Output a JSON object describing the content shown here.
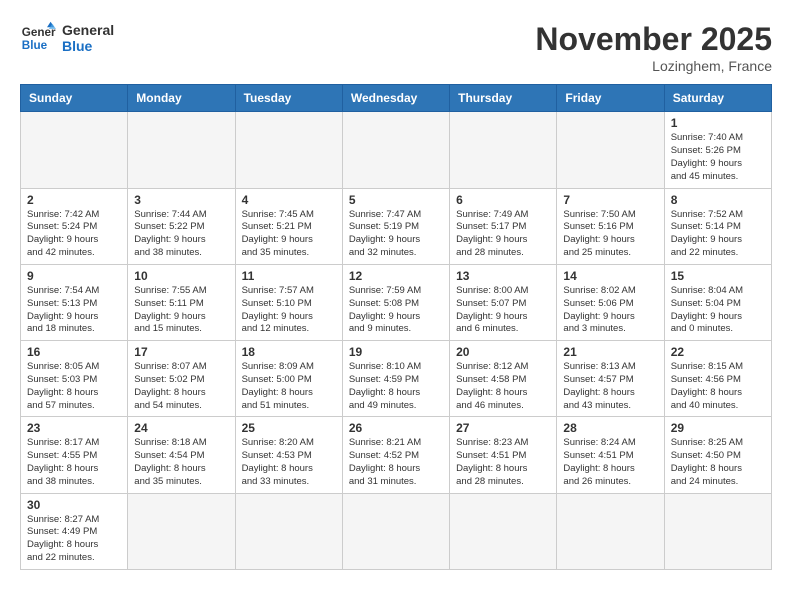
{
  "header": {
    "logo_general": "General",
    "logo_blue": "Blue",
    "month_title": "November 2025",
    "location": "Lozinghem, France"
  },
  "days_of_week": [
    "Sunday",
    "Monday",
    "Tuesday",
    "Wednesday",
    "Thursday",
    "Friday",
    "Saturday"
  ],
  "weeks": [
    [
      {
        "day": "",
        "info": ""
      },
      {
        "day": "",
        "info": ""
      },
      {
        "day": "",
        "info": ""
      },
      {
        "day": "",
        "info": ""
      },
      {
        "day": "",
        "info": ""
      },
      {
        "day": "",
        "info": ""
      },
      {
        "day": "1",
        "info": "Sunrise: 7:40 AM\nSunset: 5:26 PM\nDaylight: 9 hours\nand 45 minutes."
      }
    ],
    [
      {
        "day": "2",
        "info": "Sunrise: 7:42 AM\nSunset: 5:24 PM\nDaylight: 9 hours\nand 42 minutes."
      },
      {
        "day": "3",
        "info": "Sunrise: 7:44 AM\nSunset: 5:22 PM\nDaylight: 9 hours\nand 38 minutes."
      },
      {
        "day": "4",
        "info": "Sunrise: 7:45 AM\nSunset: 5:21 PM\nDaylight: 9 hours\nand 35 minutes."
      },
      {
        "day": "5",
        "info": "Sunrise: 7:47 AM\nSunset: 5:19 PM\nDaylight: 9 hours\nand 32 minutes."
      },
      {
        "day": "6",
        "info": "Sunrise: 7:49 AM\nSunset: 5:17 PM\nDaylight: 9 hours\nand 28 minutes."
      },
      {
        "day": "7",
        "info": "Sunrise: 7:50 AM\nSunset: 5:16 PM\nDaylight: 9 hours\nand 25 minutes."
      },
      {
        "day": "8",
        "info": "Sunrise: 7:52 AM\nSunset: 5:14 PM\nDaylight: 9 hours\nand 22 minutes."
      }
    ],
    [
      {
        "day": "9",
        "info": "Sunrise: 7:54 AM\nSunset: 5:13 PM\nDaylight: 9 hours\nand 18 minutes."
      },
      {
        "day": "10",
        "info": "Sunrise: 7:55 AM\nSunset: 5:11 PM\nDaylight: 9 hours\nand 15 minutes."
      },
      {
        "day": "11",
        "info": "Sunrise: 7:57 AM\nSunset: 5:10 PM\nDaylight: 9 hours\nand 12 minutes."
      },
      {
        "day": "12",
        "info": "Sunrise: 7:59 AM\nSunset: 5:08 PM\nDaylight: 9 hours\nand 9 minutes."
      },
      {
        "day": "13",
        "info": "Sunrise: 8:00 AM\nSunset: 5:07 PM\nDaylight: 9 hours\nand 6 minutes."
      },
      {
        "day": "14",
        "info": "Sunrise: 8:02 AM\nSunset: 5:06 PM\nDaylight: 9 hours\nand 3 minutes."
      },
      {
        "day": "15",
        "info": "Sunrise: 8:04 AM\nSunset: 5:04 PM\nDaylight: 9 hours\nand 0 minutes."
      }
    ],
    [
      {
        "day": "16",
        "info": "Sunrise: 8:05 AM\nSunset: 5:03 PM\nDaylight: 8 hours\nand 57 minutes."
      },
      {
        "day": "17",
        "info": "Sunrise: 8:07 AM\nSunset: 5:02 PM\nDaylight: 8 hours\nand 54 minutes."
      },
      {
        "day": "18",
        "info": "Sunrise: 8:09 AM\nSunset: 5:00 PM\nDaylight: 8 hours\nand 51 minutes."
      },
      {
        "day": "19",
        "info": "Sunrise: 8:10 AM\nSunset: 4:59 PM\nDaylight: 8 hours\nand 49 minutes."
      },
      {
        "day": "20",
        "info": "Sunrise: 8:12 AM\nSunset: 4:58 PM\nDaylight: 8 hours\nand 46 minutes."
      },
      {
        "day": "21",
        "info": "Sunrise: 8:13 AM\nSunset: 4:57 PM\nDaylight: 8 hours\nand 43 minutes."
      },
      {
        "day": "22",
        "info": "Sunrise: 8:15 AM\nSunset: 4:56 PM\nDaylight: 8 hours\nand 40 minutes."
      }
    ],
    [
      {
        "day": "23",
        "info": "Sunrise: 8:17 AM\nSunset: 4:55 PM\nDaylight: 8 hours\nand 38 minutes."
      },
      {
        "day": "24",
        "info": "Sunrise: 8:18 AM\nSunset: 4:54 PM\nDaylight: 8 hours\nand 35 minutes."
      },
      {
        "day": "25",
        "info": "Sunrise: 8:20 AM\nSunset: 4:53 PM\nDaylight: 8 hours\nand 33 minutes."
      },
      {
        "day": "26",
        "info": "Sunrise: 8:21 AM\nSunset: 4:52 PM\nDaylight: 8 hours\nand 31 minutes."
      },
      {
        "day": "27",
        "info": "Sunrise: 8:23 AM\nSunset: 4:51 PM\nDaylight: 8 hours\nand 28 minutes."
      },
      {
        "day": "28",
        "info": "Sunrise: 8:24 AM\nSunset: 4:51 PM\nDaylight: 8 hours\nand 26 minutes."
      },
      {
        "day": "29",
        "info": "Sunrise: 8:25 AM\nSunset: 4:50 PM\nDaylight: 8 hours\nand 24 minutes."
      }
    ],
    [
      {
        "day": "30",
        "info": "Sunrise: 8:27 AM\nSunset: 4:49 PM\nDaylight: 8 hours\nand 22 minutes."
      },
      {
        "day": "",
        "info": ""
      },
      {
        "day": "",
        "info": ""
      },
      {
        "day": "",
        "info": ""
      },
      {
        "day": "",
        "info": ""
      },
      {
        "day": "",
        "info": ""
      },
      {
        "day": "",
        "info": ""
      }
    ]
  ]
}
